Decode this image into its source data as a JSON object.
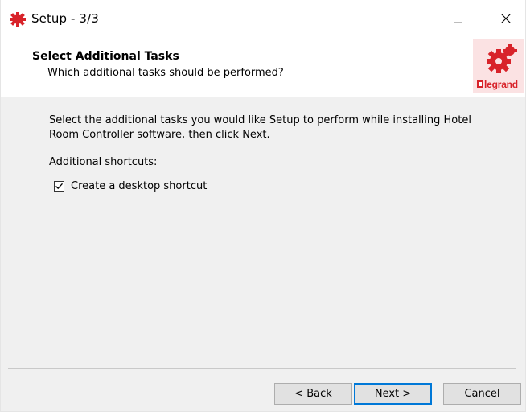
{
  "window": {
    "title": "Setup - 3/3",
    "controls": {
      "minimize_icon": "minimize-icon",
      "maximize_icon": "maximize-icon",
      "close_icon": "close-icon"
    }
  },
  "header": {
    "title": "Select Additional Tasks",
    "subtitle": "Which additional tasks should be performed?",
    "logo_text": "legrand"
  },
  "content": {
    "description": "Select the additional tasks you would like Setup to perform while installing Hotel Room Controller software, then click Next.",
    "shortcuts_label": "Additional shortcuts:",
    "tasks": [
      {
        "label": "Create a desktop shortcut",
        "checked": true
      }
    ]
  },
  "buttons": {
    "back": "< Back",
    "next": "Next >",
    "cancel": "Cancel"
  },
  "colors": {
    "brand": "#d8232a",
    "accent": "#0078d7"
  }
}
